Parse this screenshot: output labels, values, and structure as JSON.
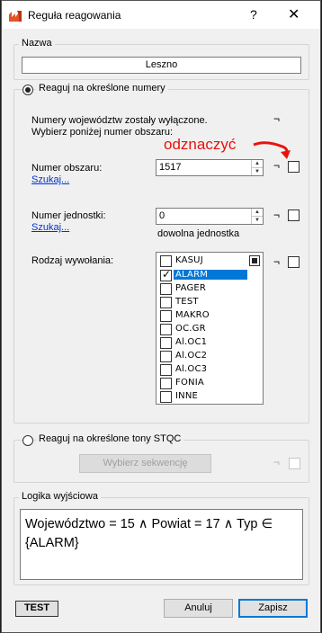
{
  "window": {
    "title": "Reguła reagowania",
    "help": "?",
    "close": "✕"
  },
  "name_group": {
    "legend": "Nazwa",
    "value": "Leszno"
  },
  "numbers_section": {
    "radio_label": "Reaguj na określone numery",
    "info_line1": "Numery województw zostały wyłączone.",
    "info_line2": "Wybierz poniżej numer obszaru:",
    "negation_symbol": "¬",
    "area_label": "Numer obszaru:",
    "area_link": "Szukaj...",
    "area_value": "1517",
    "unit_label": "Numer jednostki:",
    "unit_link": "Szukaj...",
    "unit_value": "0",
    "unit_hint": "dowolna jednostka",
    "call_type_label": "Rodzaj wywołania:",
    "call_types": [
      {
        "label": "KASUJ",
        "checked": false
      },
      {
        "label": "ALARM",
        "checked": true
      },
      {
        "label": "PAGER",
        "checked": false
      },
      {
        "label": "TEST",
        "checked": false
      },
      {
        "label": "MAKRO",
        "checked": false
      },
      {
        "label": "OC.GR",
        "checked": false
      },
      {
        "label": "Al.OC1",
        "checked": false
      },
      {
        "label": "Al.OC2",
        "checked": false
      },
      {
        "label": "Al.OC3",
        "checked": false
      },
      {
        "label": "FONIA",
        "checked": false
      },
      {
        "label": "INNE",
        "checked": false
      }
    ]
  },
  "stqc_section": {
    "radio_label": "Reaguj na określone tony STQC",
    "button": "Wybierz sekwencję"
  },
  "output_logic": {
    "legend": "Logika wyjściowa",
    "text": "Województwo = 15 ∧ Powiat = 17 ∧ Typ ∈ {ALARM}"
  },
  "annotation": {
    "text": "odznaczyć",
    "color": "#e8120c"
  },
  "footer": {
    "test": "TEST",
    "cancel": "Anuluj",
    "save": "Zapisz"
  }
}
